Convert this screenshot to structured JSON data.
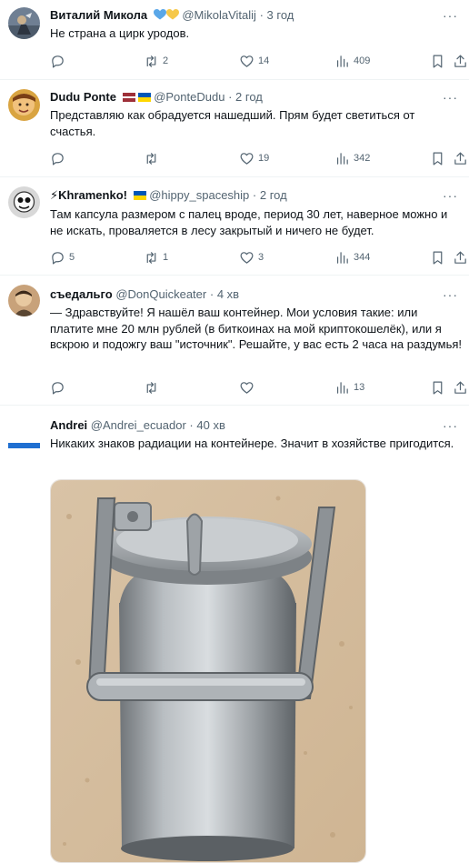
{
  "tweets": [
    {
      "name": "Виталий Микола",
      "handle": "@MikolaVitalij",
      "time": "3 год",
      "text": "Не страна а цирк уродов.",
      "replies": "",
      "retweets": "2",
      "likes": "14",
      "views": "409"
    },
    {
      "name": "Dudu Ponte",
      "handle": "@PonteDudu",
      "time": "2 год",
      "text": "Представляю как обрадуется нашедший. Прям будет светиться от счастья.",
      "replies": "",
      "retweets": "",
      "likes": "19",
      "views": "342"
    },
    {
      "name": "⚡Khramenko!",
      "handle": "@hippy_spaceship",
      "time": "2 год",
      "text": "Там капсула размером с палец вроде, период 30 лет, наверное можно и не искать, проваляется в лесу закрытый и ничего не будет.",
      "replies": "5",
      "retweets": "1",
      "likes": "3",
      "views": "344"
    },
    {
      "name": "съедальго",
      "handle": "@DonQuickeater",
      "time": "4 хв",
      "text": "— Здравствуйте! Я нашёл ваш контейнер. Мои условия такие: или платите мне 20 млн рублей (в биткоинах на мой криптокошелёк), или я вскрою и подожгу ваш \"источник\". Решайте, у вас есть 2 часа на раздумья!",
      "replies": "",
      "retweets": "",
      "likes": "",
      "views": "13"
    },
    {
      "name": "Andrei",
      "handle": "@Andrei_ecuador",
      "time": "40 хв",
      "text": "Никаких знаков радиации на контейнере. Значит в хозяйстве пригодится."
    }
  ],
  "separator": "·",
  "more_label": "···",
  "icons": {
    "reply": "reply-icon",
    "retweet": "retweet-icon",
    "like": "heart-icon",
    "views": "views-chart-icon",
    "bookmark": "bookmark-icon",
    "share": "share-icon"
  },
  "colors": {
    "text": "#0f1419",
    "secondary": "#536471",
    "divider": "#eff3f4",
    "heart_blue": "#5aa7e8",
    "heart_yellow": "#f6c84a",
    "ukraine_blue": "#0057b7",
    "ukraine_yellow": "#ffd700",
    "latvia_red": "#9e3039"
  }
}
